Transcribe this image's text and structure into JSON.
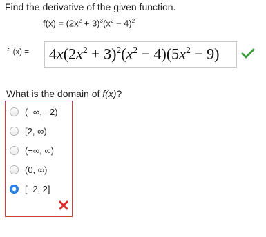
{
  "question": {
    "prompt": "Find the derivative of the given function.",
    "function_lhs": "f(x) = (2x",
    "function_mid1": " + 3)",
    "function_mid2": "(x",
    "function_tail": " − 4)",
    "exp2": "2",
    "exp3": "3"
  },
  "derivative": {
    "label": "f '(x) =",
    "coefficient": "4",
    "var": "x",
    "part_a": "(2",
    "part_b": " + 3)",
    "part_c": "(",
    "part_d": " − 4)(5",
    "part_e": " − 9)",
    "exp2": "2",
    "status": "correct"
  },
  "domain_question": {
    "text_prefix": "What is the domain of ",
    "text_func": "f(x)",
    "text_suffix": "?",
    "options": [
      {
        "label": "(−∞, −2)",
        "selected": false
      },
      {
        "label": "[2, ∞)",
        "selected": false
      },
      {
        "label": "(−∞, ∞)",
        "selected": false
      },
      {
        "label": "(0, ∞)",
        "selected": false
      },
      {
        "label": "[−2, 2]",
        "selected": true
      }
    ],
    "status": "incorrect"
  },
  "colors": {
    "check": "#3a9a3a",
    "error": "#e0282a",
    "options_border": "#d23b3b",
    "radio_selected": "#2c86e8"
  }
}
